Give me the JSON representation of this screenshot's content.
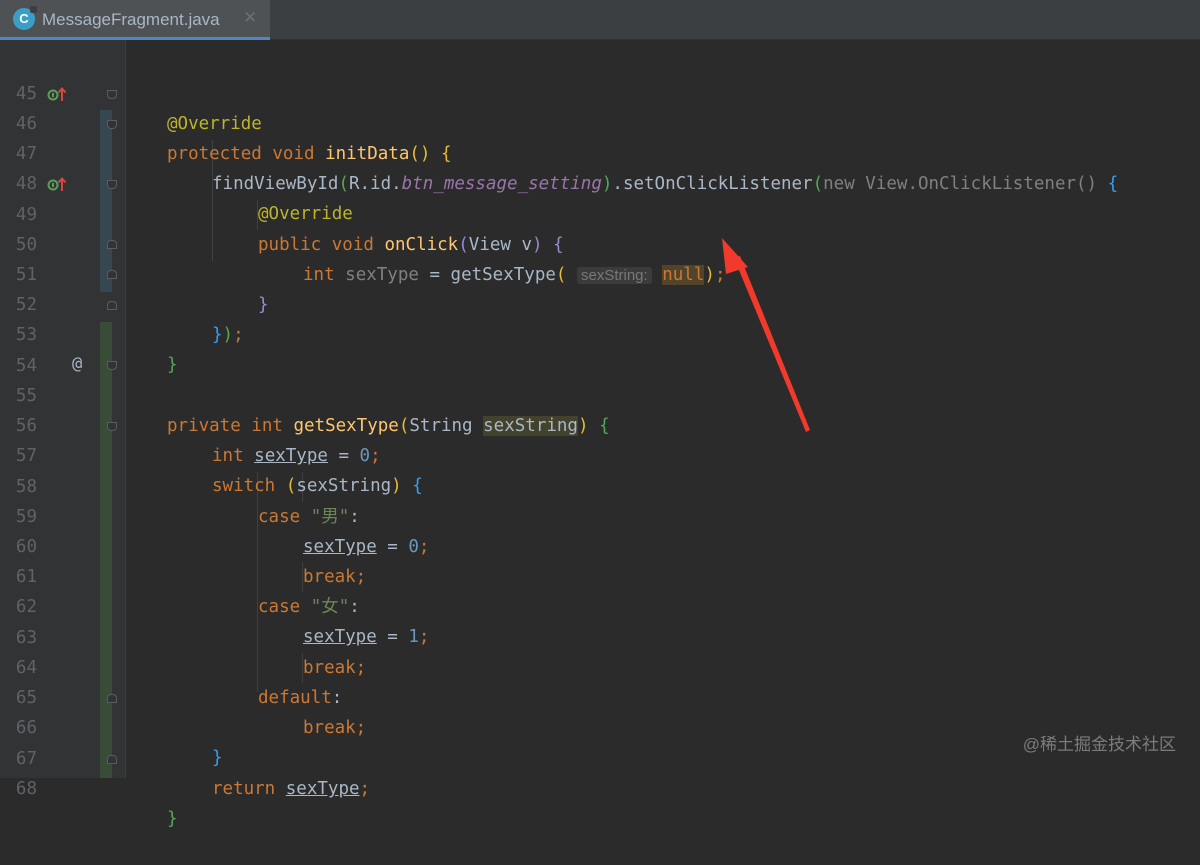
{
  "tab": {
    "icon": "C",
    "title": "MessageFragment.java",
    "close": "✕"
  },
  "watermark": "@稀土掘金技术社区",
  "annotations": {
    "red_arrow_target": "null argument"
  },
  "lines": [
    {
      "n": "45",
      "c": "@Override"
    },
    {
      "n": "46",
      "c": "protected void initData() {"
    },
    {
      "n": "47",
      "c": "findViewById(R.id.btn_message_setting).setOnClickListener(new View.OnClickListener() {"
    },
    {
      "n": "48",
      "c": "@Override"
    },
    {
      "n": "49",
      "c": "public void onClick(View v) {"
    },
    {
      "n": "50",
      "c": "int sexType = getSexType( sexString: null);"
    },
    {
      "n": "51",
      "c": "}"
    },
    {
      "n": "52",
      "c": "});"
    },
    {
      "n": "53",
      "c": "}"
    },
    {
      "n": "54",
      "c": ""
    },
    {
      "n": "55",
      "c": "private int getSexType(String sexString) {"
    },
    {
      "n": "56",
      "c": "int sexType = 0;"
    },
    {
      "n": "57",
      "c": "switch (sexString) {"
    },
    {
      "n": "58",
      "c": "case \"男\":"
    },
    {
      "n": "59",
      "c": "sexType = 0;"
    },
    {
      "n": "60",
      "c": "break;"
    },
    {
      "n": "61",
      "c": "case \"女\":"
    },
    {
      "n": "62",
      "c": "sexType = 1;"
    },
    {
      "n": "63",
      "c": "break;"
    },
    {
      "n": "64",
      "c": "default:"
    },
    {
      "n": "65",
      "c": "break;"
    },
    {
      "n": "66",
      "c": "}"
    },
    {
      "n": "67",
      "c": "return sexType;"
    },
    {
      "n": "68",
      "c": "}"
    }
  ],
  "tokens": {
    "override": "@Override",
    "protected": "protected",
    "public": "public",
    "private": "private",
    "void": "void",
    "int": "int",
    "new": "new",
    "switch": "switch",
    "case": "case",
    "break": "break;",
    "default": "default",
    "return": "return",
    "initData": "initData",
    "onClick": "onClick",
    "getSexType": "getSexType",
    "findViewById": "findViewById",
    "R_id": "R.id.",
    "btn_message_setting": "btn_message_setting",
    "setOnClickListener": ".setOnClickListener",
    "view_onclicklistener": "View.OnClickListener()",
    "view_v": "View v",
    "sexType": "sexType",
    "sexString": "sexString",
    "string_type": "String",
    "hint_sexString": "sexString:",
    "null": "null",
    "zero": "0",
    "one": "1",
    "str_male": "\"男\"",
    "str_female": "\"女\"",
    "at_symbol": "@"
  }
}
